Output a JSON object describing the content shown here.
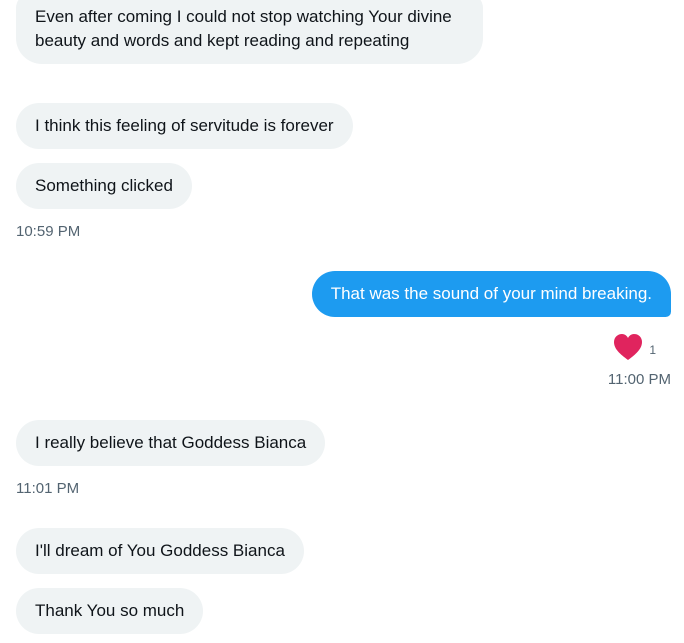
{
  "messages": [
    {
      "text": "Even after coming I could not stop watching Your divine beauty and words and kept reading and repeating",
      "direction": "incoming"
    },
    {
      "text": "I think this feeling of servitude is forever",
      "direction": "incoming"
    },
    {
      "text": "Something clicked",
      "direction": "incoming"
    },
    {
      "text": "That was the sound of your mind breaking.",
      "direction": "outgoing"
    },
    {
      "text": "I really believe that Goddess Bianca",
      "direction": "incoming"
    },
    {
      "text": "I'll dream of You Goddess Bianca",
      "direction": "incoming"
    },
    {
      "text": "Thank You so much",
      "direction": "incoming"
    }
  ],
  "timestamps": {
    "t1": "10:59 PM",
    "t2": "11:00 PM",
    "t3": "11:01 PM"
  },
  "reaction": {
    "icon": "heart-icon",
    "count": "1",
    "color": "#e0245e"
  },
  "colors": {
    "incoming_bubble": "#eff3f4",
    "outgoing_bubble": "#1d9bf0",
    "text": "#0f1419",
    "timestamp": "#536471"
  }
}
